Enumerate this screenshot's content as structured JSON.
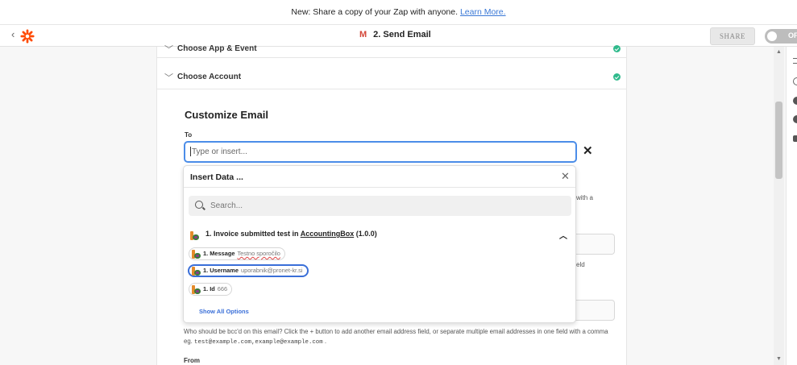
{
  "banner": {
    "text": "New: Share a copy of your Zap with anyone. ",
    "link": "Learn More."
  },
  "header": {
    "back_icon": "chevron-left-icon",
    "logo_icon": "zapier-logo",
    "app_icon": "gmail-icon",
    "step_title": "2. Send Email",
    "share_label": "SHARE",
    "toggle_label": "OFF"
  },
  "sections": [
    {
      "label": "Choose App & Event",
      "status": "complete"
    },
    {
      "label": "Choose Account",
      "status": "complete"
    }
  ],
  "customize": {
    "title": "Customize Email",
    "to_label": "To",
    "to_placeholder": "Type or insert...",
    "side_text_1": "with a",
    "side_text_2": "eld",
    "bcc_help": "Who should be bcc'd on this email? Click the + button to add another email address field, or separate multiple email addresses in one field with a comma eg.",
    "bcc_example": "test@example.com,example@example.com",
    "bcc_tail": ".",
    "from_label": "From"
  },
  "insert_data": {
    "title": "Insert Data ...",
    "search_placeholder": "Search...",
    "group": {
      "prefix": "1. Invoice submitted test in ",
      "app_name": "AccountingBox",
      "suffix": " (1.0.0)",
      "expanded": true
    },
    "fields": [
      {
        "key": "1. Message",
        "value": "Testno sporočilo",
        "selected": false
      },
      {
        "key": "1. Username",
        "value": "uporabnik@pronet-kr.si",
        "selected": true
      },
      {
        "key": "1. Id",
        "value": "666",
        "selected": false
      }
    ],
    "show_all": "Show All Options"
  },
  "colors": {
    "accent": "#4b8de8",
    "success": "#2fba8c",
    "link": "#3a78d6",
    "zapier_orange": "#ff4a00"
  }
}
